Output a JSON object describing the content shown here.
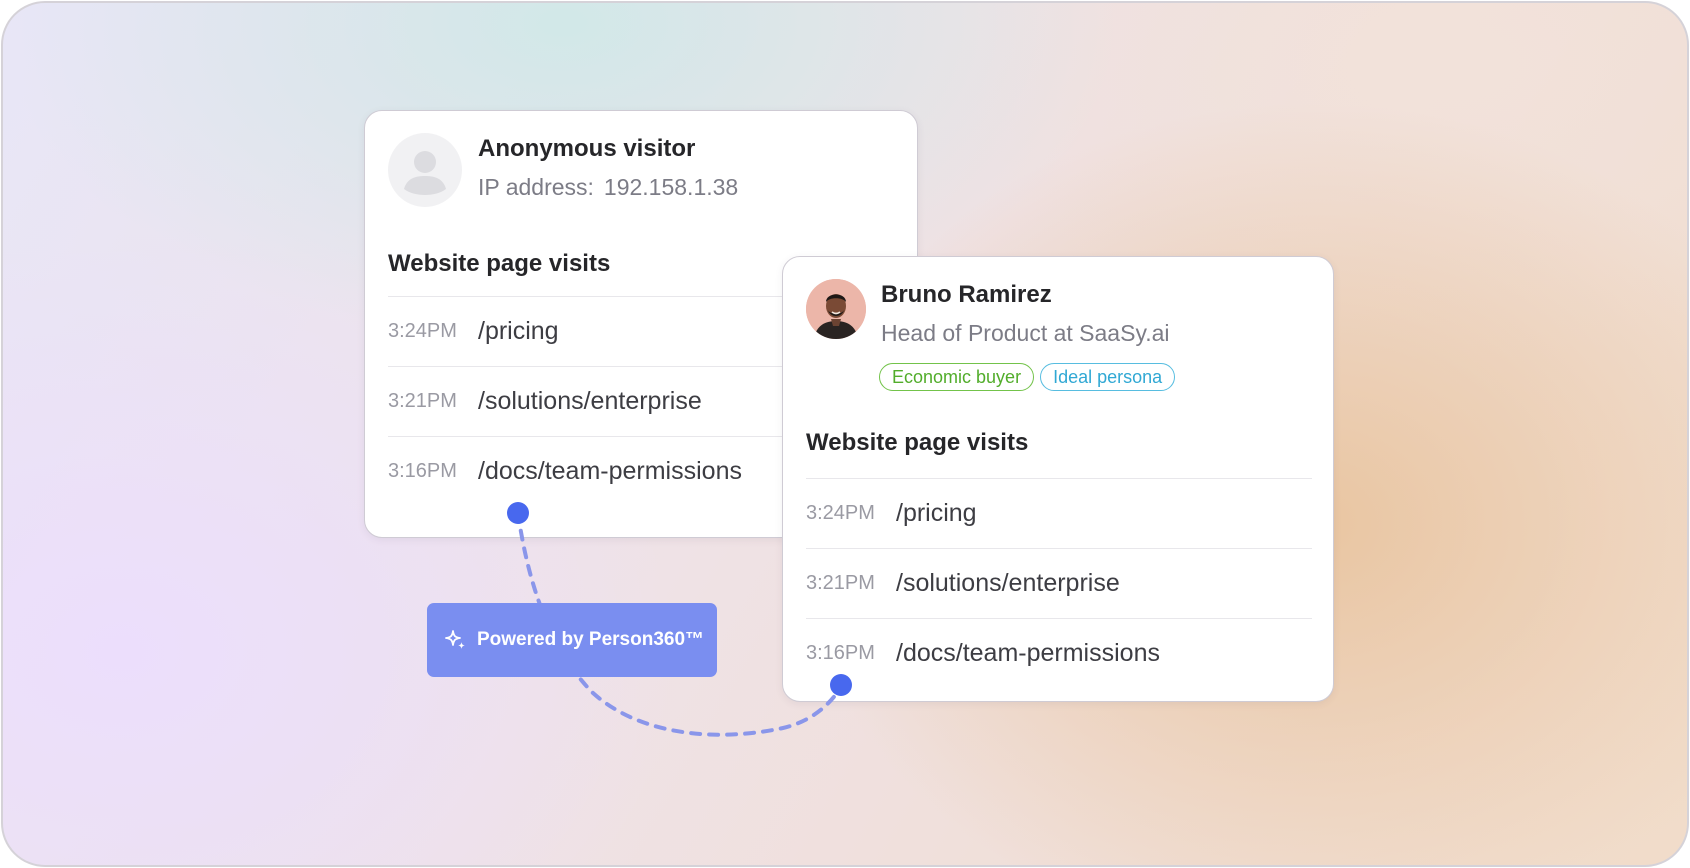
{
  "anonymous_card": {
    "title": "Anonymous visitor",
    "ip_label": "IP address:",
    "ip_value": "192.158.1.38",
    "section_title": "Website page visits",
    "visits": [
      {
        "time": "3:24PM",
        "path": "/pricing"
      },
      {
        "time": "3:21PM",
        "path": "/solutions/enterprise"
      },
      {
        "time": "3:16PM",
        "path": "/docs/team-permissions"
      }
    ]
  },
  "identified_card": {
    "name": "Bruno Ramirez",
    "role": "Head of Product at SaaSy.ai",
    "tags": [
      "Economic buyer",
      "Ideal persona"
    ],
    "section_title": "Website page visits",
    "visits": [
      {
        "time": "3:24PM",
        "path": "/pricing"
      },
      {
        "time": "3:21PM",
        "path": "/solutions/enterprise"
      },
      {
        "time": "3:16PM",
        "path": "/docs/team-permissions"
      }
    ]
  },
  "badge": {
    "icon": "sparkle-icon",
    "label": "Powered by Person360™"
  },
  "colors": {
    "accent": "#7a8ef0",
    "connector": "#8a96ea",
    "dot": "#4868ee",
    "tag_green": "#52ad2b",
    "tag_blue": "#30a8d4"
  }
}
